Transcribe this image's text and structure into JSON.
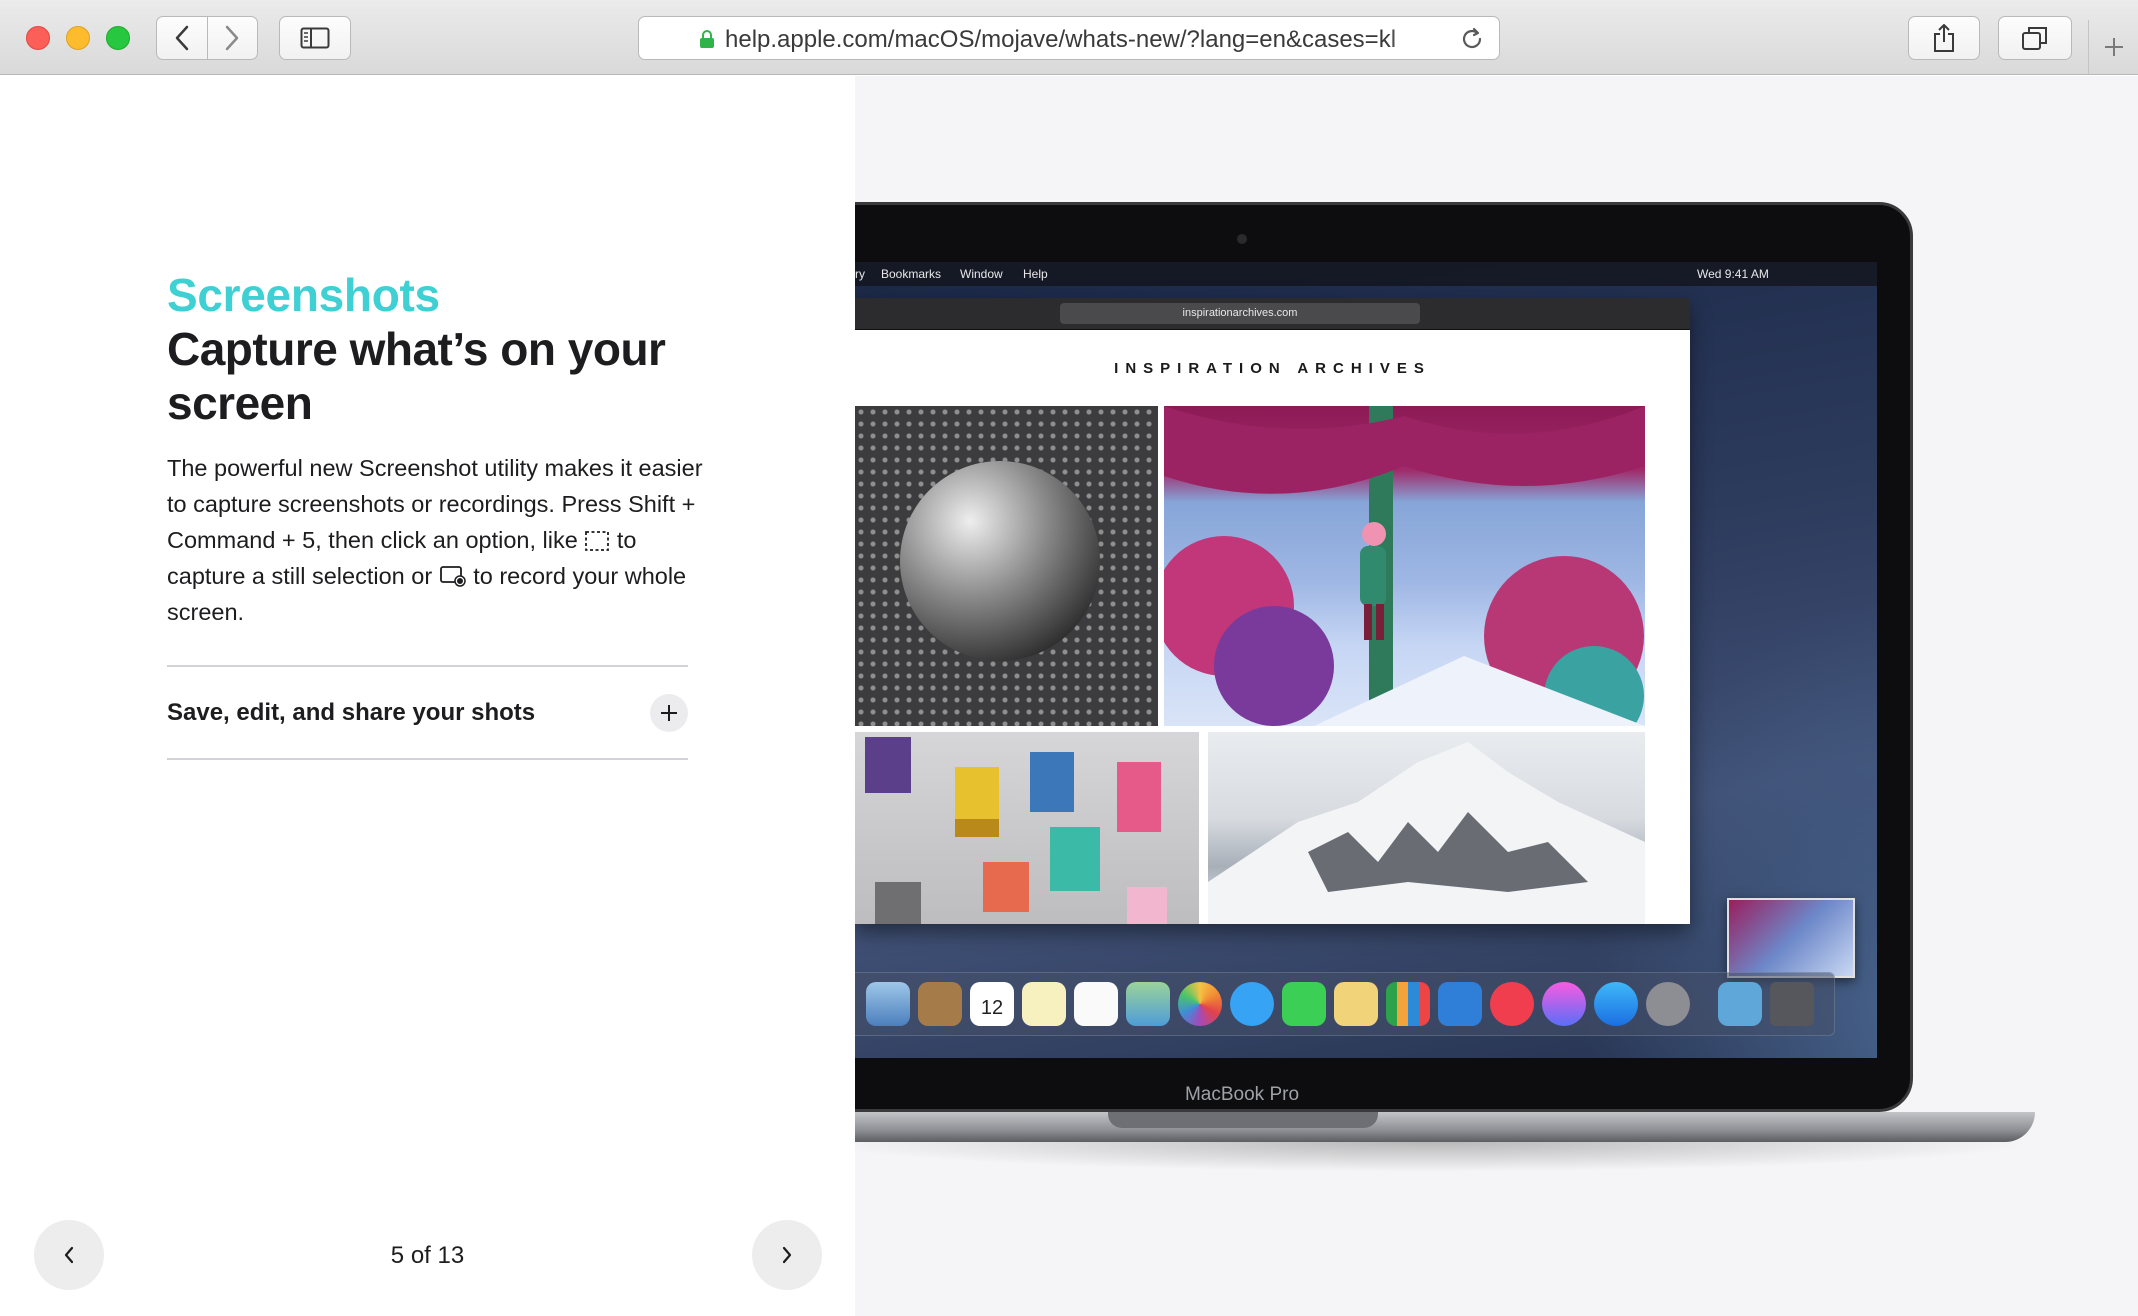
{
  "browser": {
    "url": "help.apple.com/macOS/mojave/whats-new/?lang=en&cases=kl",
    "buttons": {
      "back": "back",
      "forward": "forward",
      "sidebar": "sidebar",
      "share": "share",
      "tabs": "show tabs",
      "new_tab": "new tab",
      "reload": "reload"
    }
  },
  "article": {
    "eyebrow": "Screenshots",
    "headline": "Capture what’s on your screen",
    "body_part1": "The powerful new Screenshot utility makes it easier to capture screenshots or recordings. Press Shift + Command + 5, then click an option, like",
    "body_part2": "to capture a still selection or",
    "body_part3": "to record your whole screen.",
    "accordion_label": "Save, edit, and share your shots"
  },
  "pager": {
    "text": "5 of 13"
  },
  "illustration": {
    "menubar_left": [
      "ry",
      "Bookmarks",
      "Window",
      "Help"
    ],
    "menubar_clock": "Wed 9:41 AM",
    "inner_url": "inspirationarchives.com",
    "site_title": "INSPIRATION ARCHIVES",
    "calendar_day": "12",
    "device_label": "MacBook Pro"
  },
  "colors": {
    "accent": "#3fd0d4",
    "text": "#1d1d1f",
    "divider": "#d2d2d7"
  }
}
